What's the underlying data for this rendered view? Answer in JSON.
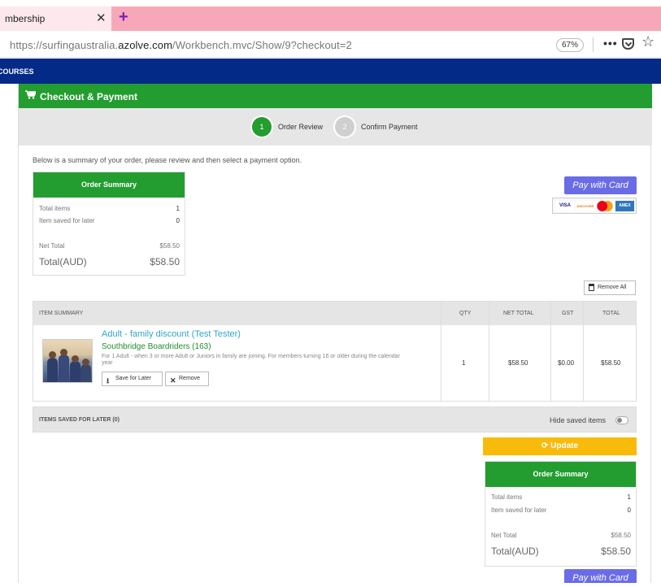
{
  "browser": {
    "tab_title": "mbership",
    "tab_close": "✕",
    "new_tab": "+",
    "url_prefix": "https://surfingaustralia.",
    "url_domain": "azolve.com",
    "url_path": "/Workbench.mvc/Show/9?checkout=2",
    "zoom": "67%",
    "menu_dots": "•••",
    "star": "☆"
  },
  "site_nav": {
    "label": "COURSES"
  },
  "panel": {
    "title": "Checkout & Payment"
  },
  "steps": [
    {
      "number": "1",
      "label": "Order Review"
    },
    {
      "number": "2",
      "label": "Confirm Payment"
    }
  ],
  "intro_text": "Below is a summary of your order, please review and then select a payment option.",
  "order_summary": {
    "title": "Order Summary",
    "total_items_label": "Total items",
    "total_items_value": "1",
    "saved_label": "Item saved for later",
    "saved_value": "0",
    "net_total_label": "Net Total",
    "net_total_value": "$58.50",
    "total_label": "Total(AUD)",
    "total_value": "$58.50"
  },
  "pay_button": {
    "label": "Pay with Card"
  },
  "cards": [
    "VISA",
    "DISCOVER",
    "MC",
    "AMEX"
  ],
  "remove_all": {
    "label": "Remove All"
  },
  "table": {
    "headers": [
      "ITEM SUMMARY",
      "QTY",
      "NET TOTAL",
      "GST",
      "TOTAL"
    ],
    "item": {
      "title": "Adult - family discount (Test Tester)",
      "club": "Southbridge Boardriders (163)",
      "description": "For 1 Adult - when 3 or more Adult or Juniors in family are joining. For members turning 16 or older during the calendar year",
      "save_label": "Save for Later",
      "remove_label": "Remove",
      "qty": "1",
      "net_total": "$58.50",
      "gst": "$0.00",
      "total": "$58.50"
    }
  },
  "saved_section": {
    "label": "ITEMS SAVED FOR LATER (0)",
    "hide_label": "Hide saved items"
  },
  "update_button": {
    "label": "Update",
    "icon": "⟳"
  },
  "colors": {
    "green": "#239d30",
    "navy": "#022a86",
    "pay": "#6a6ce6",
    "update": "#f8bb0a",
    "link": "#31a5c9"
  }
}
